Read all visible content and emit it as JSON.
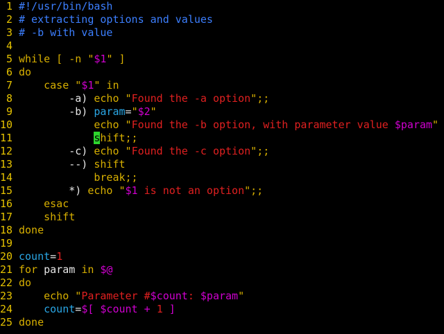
{
  "editor": {
    "lines": [
      {
        "num": "1",
        "tokens": [
          {
            "t": "#!/usr/bin/bash",
            "k": "comment"
          }
        ]
      },
      {
        "num": "2",
        "tokens": [
          {
            "t": "# extracting options and values",
            "k": "comment"
          }
        ]
      },
      {
        "num": "3",
        "tokens": [
          {
            "t": "# -b with value",
            "k": "comment"
          }
        ]
      },
      {
        "num": "4",
        "tokens": []
      },
      {
        "num": "5",
        "tokens": [
          {
            "t": "while",
            "k": "keyword"
          },
          {
            "t": " [ -n ",
            "k": "keyword"
          },
          {
            "t": "\"",
            "k": "keyword"
          },
          {
            "t": "$1",
            "k": "variable"
          },
          {
            "t": "\"",
            "k": "keyword"
          },
          {
            "t": " ]",
            "k": "keyword"
          }
        ]
      },
      {
        "num": "6",
        "tokens": [
          {
            "t": "do",
            "k": "keyword"
          }
        ]
      },
      {
        "num": "7",
        "tokens": [
          {
            "t": "    ",
            "k": "text"
          },
          {
            "t": "case",
            "k": "keyword"
          },
          {
            "t": " \"",
            "k": "keyword"
          },
          {
            "t": "$1",
            "k": "variable"
          },
          {
            "t": "\"",
            "k": "keyword"
          },
          {
            "t": " in",
            "k": "keyword"
          }
        ]
      },
      {
        "num": "8",
        "tokens": [
          {
            "t": "        -a) ",
            "k": "text"
          },
          {
            "t": "echo",
            "k": "keyword"
          },
          {
            "t": " \"",
            "k": "keyword"
          },
          {
            "t": "Found the -a option",
            "k": "string"
          },
          {
            "t": "\"",
            "k": "keyword"
          },
          {
            "t": ";;",
            "k": "keyword"
          }
        ]
      },
      {
        "num": "9",
        "tokens": [
          {
            "t": "        -b) ",
            "k": "text"
          },
          {
            "t": "param",
            "k": "ident"
          },
          {
            "t": "=",
            "k": "text"
          },
          {
            "t": "\"",
            "k": "keyword"
          },
          {
            "t": "$2",
            "k": "variable"
          },
          {
            "t": "\"",
            "k": "keyword"
          }
        ]
      },
      {
        "num": "10",
        "tokens": [
          {
            "t": "            ",
            "k": "text"
          },
          {
            "t": "echo",
            "k": "keyword"
          },
          {
            "t": " \"",
            "k": "keyword"
          },
          {
            "t": "Found the -b option, with parameter value ",
            "k": "string"
          },
          {
            "t": "$param",
            "k": "variable"
          },
          {
            "t": "\"",
            "k": "keyword"
          }
        ]
      },
      {
        "num": "11",
        "tokens": [
          {
            "t": "            ",
            "k": "text"
          },
          {
            "t": "s",
            "k": "cursor"
          },
          {
            "t": "hift",
            "k": "keyword"
          },
          {
            "t": ";;",
            "k": "keyword"
          }
        ]
      },
      {
        "num": "12",
        "tokens": [
          {
            "t": "        -c) ",
            "k": "text"
          },
          {
            "t": "echo",
            "k": "keyword"
          },
          {
            "t": " \"",
            "k": "keyword"
          },
          {
            "t": "Found the -c option",
            "k": "string"
          },
          {
            "t": "\"",
            "k": "keyword"
          },
          {
            "t": ";;",
            "k": "keyword"
          }
        ]
      },
      {
        "num": "13",
        "tokens": [
          {
            "t": "        --) ",
            "k": "text"
          },
          {
            "t": "shift",
            "k": "keyword"
          }
        ]
      },
      {
        "num": "14",
        "tokens": [
          {
            "t": "            ",
            "k": "text"
          },
          {
            "t": "break",
            "k": "keyword"
          },
          {
            "t": ";;",
            "k": "keyword"
          }
        ]
      },
      {
        "num": "15",
        "tokens": [
          {
            "t": "        *) ",
            "k": "text"
          },
          {
            "t": "echo",
            "k": "keyword"
          },
          {
            "t": " \"",
            "k": "keyword"
          },
          {
            "t": "$1",
            "k": "variable"
          },
          {
            "t": " is not an option",
            "k": "string"
          },
          {
            "t": "\"",
            "k": "keyword"
          },
          {
            "t": ";;",
            "k": "keyword"
          }
        ]
      },
      {
        "num": "16",
        "tokens": [
          {
            "t": "    ",
            "k": "text"
          },
          {
            "t": "esac",
            "k": "keyword"
          }
        ]
      },
      {
        "num": "17",
        "tokens": [
          {
            "t": "    ",
            "k": "text"
          },
          {
            "t": "shift",
            "k": "keyword"
          }
        ]
      },
      {
        "num": "18",
        "tokens": [
          {
            "t": "done",
            "k": "keyword"
          }
        ]
      },
      {
        "num": "19",
        "tokens": []
      },
      {
        "num": "20",
        "tokens": [
          {
            "t": "count",
            "k": "ident"
          },
          {
            "t": "=",
            "k": "text"
          },
          {
            "t": "1",
            "k": "number"
          }
        ]
      },
      {
        "num": "21",
        "tokens": [
          {
            "t": "for",
            "k": "keyword"
          },
          {
            "t": " param ",
            "k": "text"
          },
          {
            "t": "in",
            "k": "keyword"
          },
          {
            "t": " ",
            "k": "text"
          },
          {
            "t": "$@",
            "k": "variable"
          }
        ]
      },
      {
        "num": "22",
        "tokens": [
          {
            "t": "do",
            "k": "keyword"
          }
        ]
      },
      {
        "num": "23",
        "tokens": [
          {
            "t": "    ",
            "k": "text"
          },
          {
            "t": "echo",
            "k": "keyword"
          },
          {
            "t": " \"",
            "k": "keyword"
          },
          {
            "t": "Parameter #",
            "k": "string"
          },
          {
            "t": "$count",
            "k": "variable"
          },
          {
            "t": ": ",
            "k": "string"
          },
          {
            "t": "$param",
            "k": "variable"
          },
          {
            "t": "\"",
            "k": "keyword"
          }
        ]
      },
      {
        "num": "24",
        "tokens": [
          {
            "t": "    ",
            "k": "text"
          },
          {
            "t": "count",
            "k": "ident"
          },
          {
            "t": "=",
            "k": "text"
          },
          {
            "t": "$[ ",
            "k": "variable"
          },
          {
            "t": "$count",
            "k": "variable"
          },
          {
            "t": " + ",
            "k": "variable"
          },
          {
            "t": "1",
            "k": "number"
          },
          {
            "t": " ]",
            "k": "variable"
          }
        ]
      },
      {
        "num": "25",
        "tokens": [
          {
            "t": "done",
            "k": "keyword"
          }
        ]
      }
    ]
  },
  "colors": {
    "background": "#000000",
    "line_number": "#E5C200",
    "comment": "#3C7FFF",
    "keyword": "#D7AF00",
    "string": "#E02020",
    "variable": "#D000D0",
    "identifier": "#2AA7E6",
    "cursor": "#2DD62D"
  }
}
